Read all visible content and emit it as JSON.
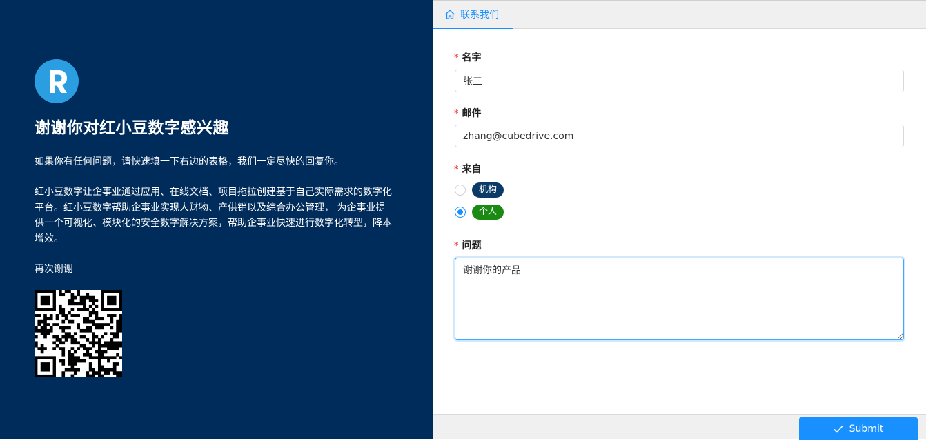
{
  "colors": {
    "left_bg": "#002c5c",
    "logo_bg": "#2a9ee0",
    "accent": "#1890ff",
    "required": "#f5222d",
    "pill_org": "#0b3a66",
    "pill_personal": "#1a8a13"
  },
  "left": {
    "logo_icon": "r-logo-icon",
    "title": "谢谢你对红小豆数字感兴趣",
    "paragraph1": "如果你有任何问题，请快速填一下右边的表格，我们一定尽快的回复你。",
    "paragraph2": "红小豆数字让企事业通过应用、在线文档、项目拖拉创建基于自己实际需求的数字化平台。红小豆数字帮助企事业实现人财物、产供销以及综合办公管理， 为企事业提供一个可视化、模块化的安全数字解决方案，帮助企事业快速进行数字化转型，降本增效。",
    "paragraph3": "再次谢谢",
    "qr_icon": "qr-code"
  },
  "tabs": [
    {
      "label": "联系我们",
      "icon": "home-icon",
      "active": true
    }
  ],
  "form": {
    "name": {
      "label": "名字",
      "required": "*",
      "value": "张三"
    },
    "email": {
      "label": "邮件",
      "required": "*",
      "value": "zhang@cubedrive.com"
    },
    "source": {
      "label": "来自",
      "required": "*",
      "options": [
        {
          "label": "机构",
          "checked": false
        },
        {
          "label": "个人",
          "checked": true
        }
      ]
    },
    "question": {
      "label": "问题",
      "required": "*",
      "value": "谢谢你的产品"
    }
  },
  "footer": {
    "submit_label": "Submit",
    "submit_icon": "check-icon"
  }
}
